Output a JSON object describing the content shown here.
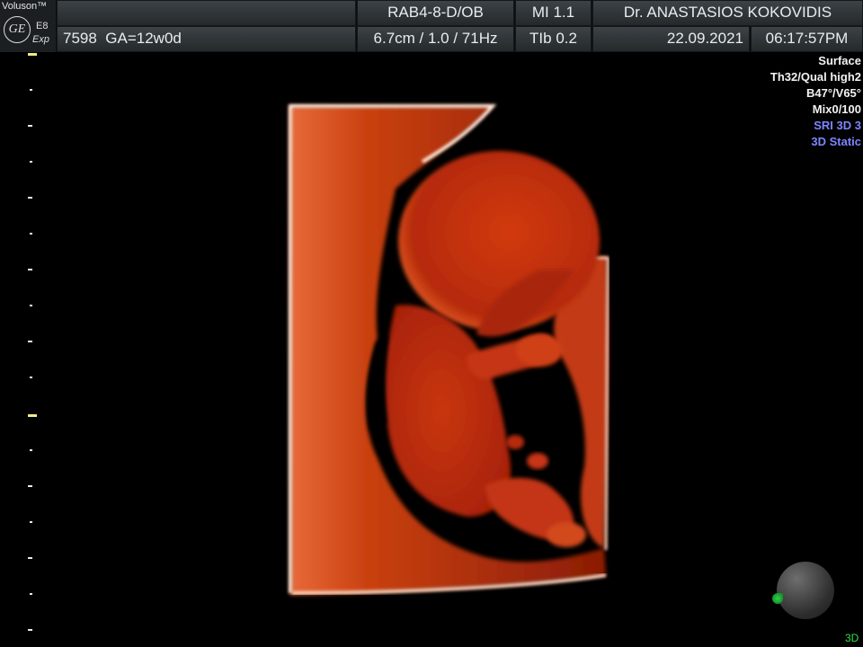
{
  "header": {
    "brand": "Voluson™",
    "logo_text": "GE",
    "model": "E8",
    "variant": "Exp",
    "patient_id": "7598",
    "gestational_age": "GA=12w0d",
    "probe": "RAB4-8-D/OB",
    "depth_info": "6.7cm / 1.0 / 71Hz",
    "mi": "MI  1.1",
    "tib": "TIb  0.2",
    "doctor": "Dr. ANASTASIOS KOKOVIDIS",
    "date": "22.09.2021",
    "time": "06:17:57PM"
  },
  "render_info": {
    "mode": "Surface",
    "threshold_quality": "Th32/Qual high2",
    "angles": "B47°/V65°",
    "mix": "Mix0/100",
    "sri": "SRI 3D 3",
    "acquisition": "3D Static"
  },
  "status": {
    "mode_indicator": "3D"
  },
  "colors": {
    "accent_blue": "#7c86ff",
    "indicator_green": "#2ee04a",
    "render_red": "#c8320f",
    "scale_yellow": "#f2e98a"
  }
}
